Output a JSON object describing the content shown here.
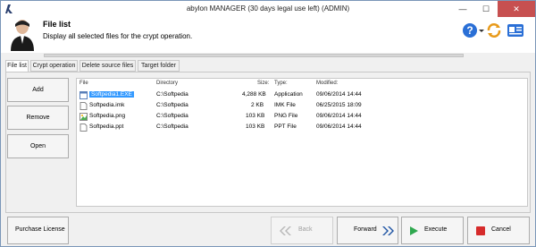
{
  "window": {
    "title": "abylon MANAGER (30 days legal use left) (ADMIN)"
  },
  "titlebar_buttons": {
    "minimize": "—",
    "maximize": "☐",
    "close": "✕"
  },
  "header": {
    "title": "File list",
    "subtitle": "Display all selected files for the crypt operation."
  },
  "tabs": [
    {
      "label": "File list",
      "active": true
    },
    {
      "label": "Crypt operation",
      "active": false
    },
    {
      "label": "Delete source files",
      "active": false
    },
    {
      "label": "Target folder",
      "active": false
    }
  ],
  "side_buttons": {
    "add": "Add",
    "remove": "Remove",
    "open": "Open"
  },
  "columns": {
    "file": "File",
    "directory": "Directory",
    "size": "Size:",
    "type": "Type:",
    "modified": "Modified:"
  },
  "files": [
    {
      "name": "Softpedia1.EXE",
      "directory": "C:\\Softpedia",
      "size": "4,288 KB",
      "type": "Application",
      "modified": "09/06/2014 14:44",
      "selected": true,
      "icon": "exe-icon"
    },
    {
      "name": "Softpedia.imk",
      "directory": "C:\\Softpedia",
      "size": "2 KB",
      "type": "IMK File",
      "modified": "06/25/2015 18:09",
      "selected": false,
      "icon": "imk-file-icon"
    },
    {
      "name": "Softpedia.png",
      "directory": "C:\\Softpedia",
      "size": "103 KB",
      "type": "PNG File",
      "modified": "09/06/2014 14:44",
      "selected": false,
      "icon": "png-file-icon"
    },
    {
      "name": "Softpedia.ppt",
      "directory": "C:\\Softpedia",
      "size": "103 KB",
      "type": "PPT File",
      "modified": "09/06/2014 14:44",
      "selected": false,
      "icon": "ppt-file-icon"
    }
  ],
  "footer": {
    "purchase": "Purchase License",
    "back": "Back",
    "forward": "Forward",
    "execute": "Execute",
    "cancel": "Cancel"
  },
  "colors": {
    "accent": "#3399ff",
    "close": "#c75050",
    "execute": "#2fa84f",
    "cancel": "#d62b2b",
    "nav_arrow": "#2156a5"
  }
}
